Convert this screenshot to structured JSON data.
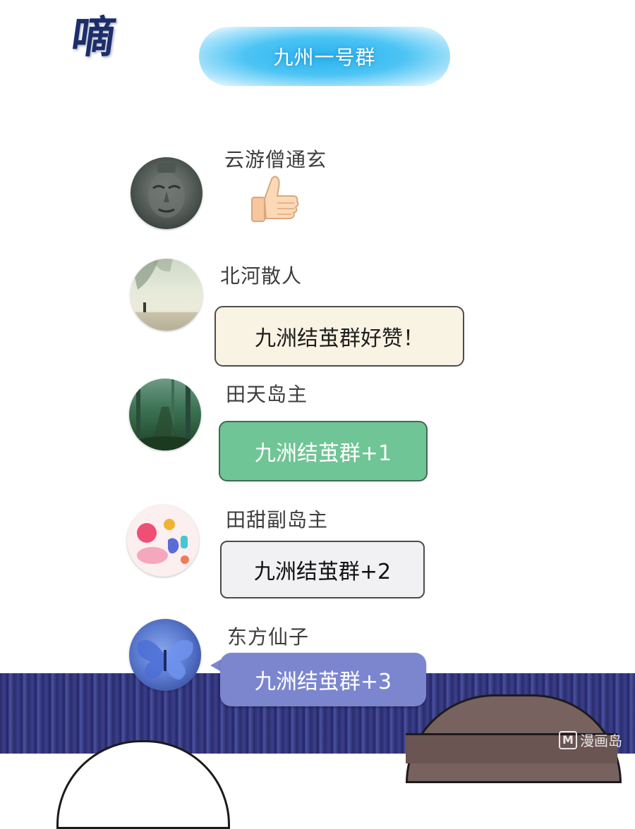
{
  "sound_effect": "嘀",
  "group": {
    "name": "九州一号群"
  },
  "messages": [
    {
      "sender": "云游僧通玄",
      "content_type": "emoji",
      "emoji": "thumbs-up-icon"
    },
    {
      "sender": "北河散人",
      "text": "九洲结茧群好赞！"
    },
    {
      "sender": "田天岛主",
      "text": "九洲结茧群+1"
    },
    {
      "sender": "田甜副岛主",
      "text": "九洲结茧群+2"
    },
    {
      "sender": "东方仙子",
      "text": "九洲结茧群+3"
    }
  ],
  "watermark": {
    "logo": "M",
    "text": "漫画岛"
  },
  "colors": {
    "header_blue": "#2ab1ee",
    "bubble_cream": "#f9f3e3",
    "bubble_green": "#6fc595",
    "bubble_gray": "#f1f0f2",
    "bubble_purple": "#7c86cf"
  }
}
